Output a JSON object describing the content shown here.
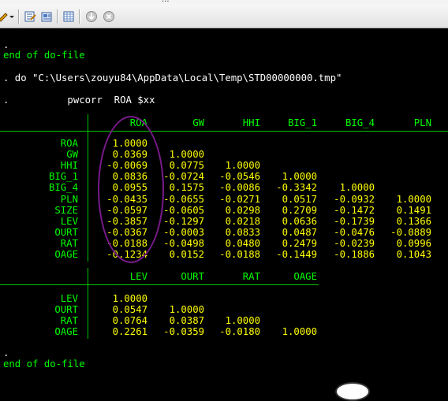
{
  "titlebar": {
    "fragment": "..."
  },
  "toolbar": {
    "icons": [
      "open-dropdown-icon",
      "do-file-editor-icon",
      "data-editor-icon",
      "data-browser-icon",
      "more-icon",
      "break-icon"
    ]
  },
  "console": {
    "lines": [
      {
        "text": ".",
        "color": "white"
      },
      {
        "text": "end of do-file",
        "color": "green"
      },
      {
        "text": ". do \"C:\\Users\\zouyu84\\AppData\\Local\\Temp\\STD00000000.tmp\"",
        "color": "white"
      },
      {
        "text": ".          pwcorr  ROA $xx",
        "color": "white"
      },
      {
        "text": ".",
        "color": "white"
      },
      {
        "text": "end of do-file",
        "color": "green"
      }
    ]
  },
  "table1": {
    "columns": [
      "ROA",
      "GW",
      "HHI",
      "BIG_1",
      "BIG_4",
      "PLN"
    ],
    "rows": [
      {
        "label": "ROA",
        "values": [
          "1.0000"
        ]
      },
      {
        "label": "GW",
        "values": [
          "0.0369",
          "1.0000"
        ]
      },
      {
        "label": "HHI",
        "values": [
          "-0.0069",
          "0.0775",
          "1.0000"
        ]
      },
      {
        "label": "BIG_1",
        "values": [
          "0.0836",
          "-0.0724",
          "-0.0546",
          "1.0000"
        ]
      },
      {
        "label": "BIG_4",
        "values": [
          "0.0955",
          "0.1575",
          "-0.0086",
          "-0.3342",
          "1.0000"
        ]
      },
      {
        "label": "PLN",
        "values": [
          "-0.0435",
          "-0.0655",
          "-0.0271",
          "0.0517",
          "-0.0932",
          "1.0000"
        ]
      },
      {
        "label": "SIZE",
        "values": [
          "-0.0597",
          "-0.0605",
          "0.0298",
          "0.2709",
          "-0.1472",
          "0.1491"
        ]
      },
      {
        "label": "LEV",
        "values": [
          "-0.3857",
          "-0.1297",
          "0.0218",
          "0.0636",
          "-0.1739",
          "0.1366"
        ]
      },
      {
        "label": "OURT",
        "values": [
          "-0.0367",
          "-0.0003",
          "0.0833",
          "0.0487",
          "-0.0476",
          "-0.0889"
        ]
      },
      {
        "label": "RAT",
        "values": [
          "-0.0188",
          "-0.0498",
          "0.0480",
          "0.2479",
          "-0.0239",
          "0.0996"
        ]
      },
      {
        "label": "OAGE",
        "values": [
          "-0.1234",
          "0.0152",
          "-0.0188",
          "-0.1449",
          "-0.1886",
          "0.1043"
        ]
      }
    ]
  },
  "table2": {
    "columns": [
      "LEV",
      "OURT",
      "RAT",
      "OAGE"
    ],
    "rows": [
      {
        "label": "LEV",
        "values": [
          "1.0000"
        ]
      },
      {
        "label": "OURT",
        "values": [
          "0.0547",
          "1.0000"
        ]
      },
      {
        "label": "RAT",
        "values": [
          "0.0764",
          "0.0387",
          "1.0000"
        ]
      },
      {
        "label": "OAGE",
        "values": [
          "0.2261",
          "-0.0359",
          "-0.0180",
          "1.0000"
        ]
      }
    ]
  },
  "colors": {
    "text": "#ffffff",
    "result": "#ffff00",
    "label": "#00ff00",
    "annotation": "#7a1a8c"
  }
}
